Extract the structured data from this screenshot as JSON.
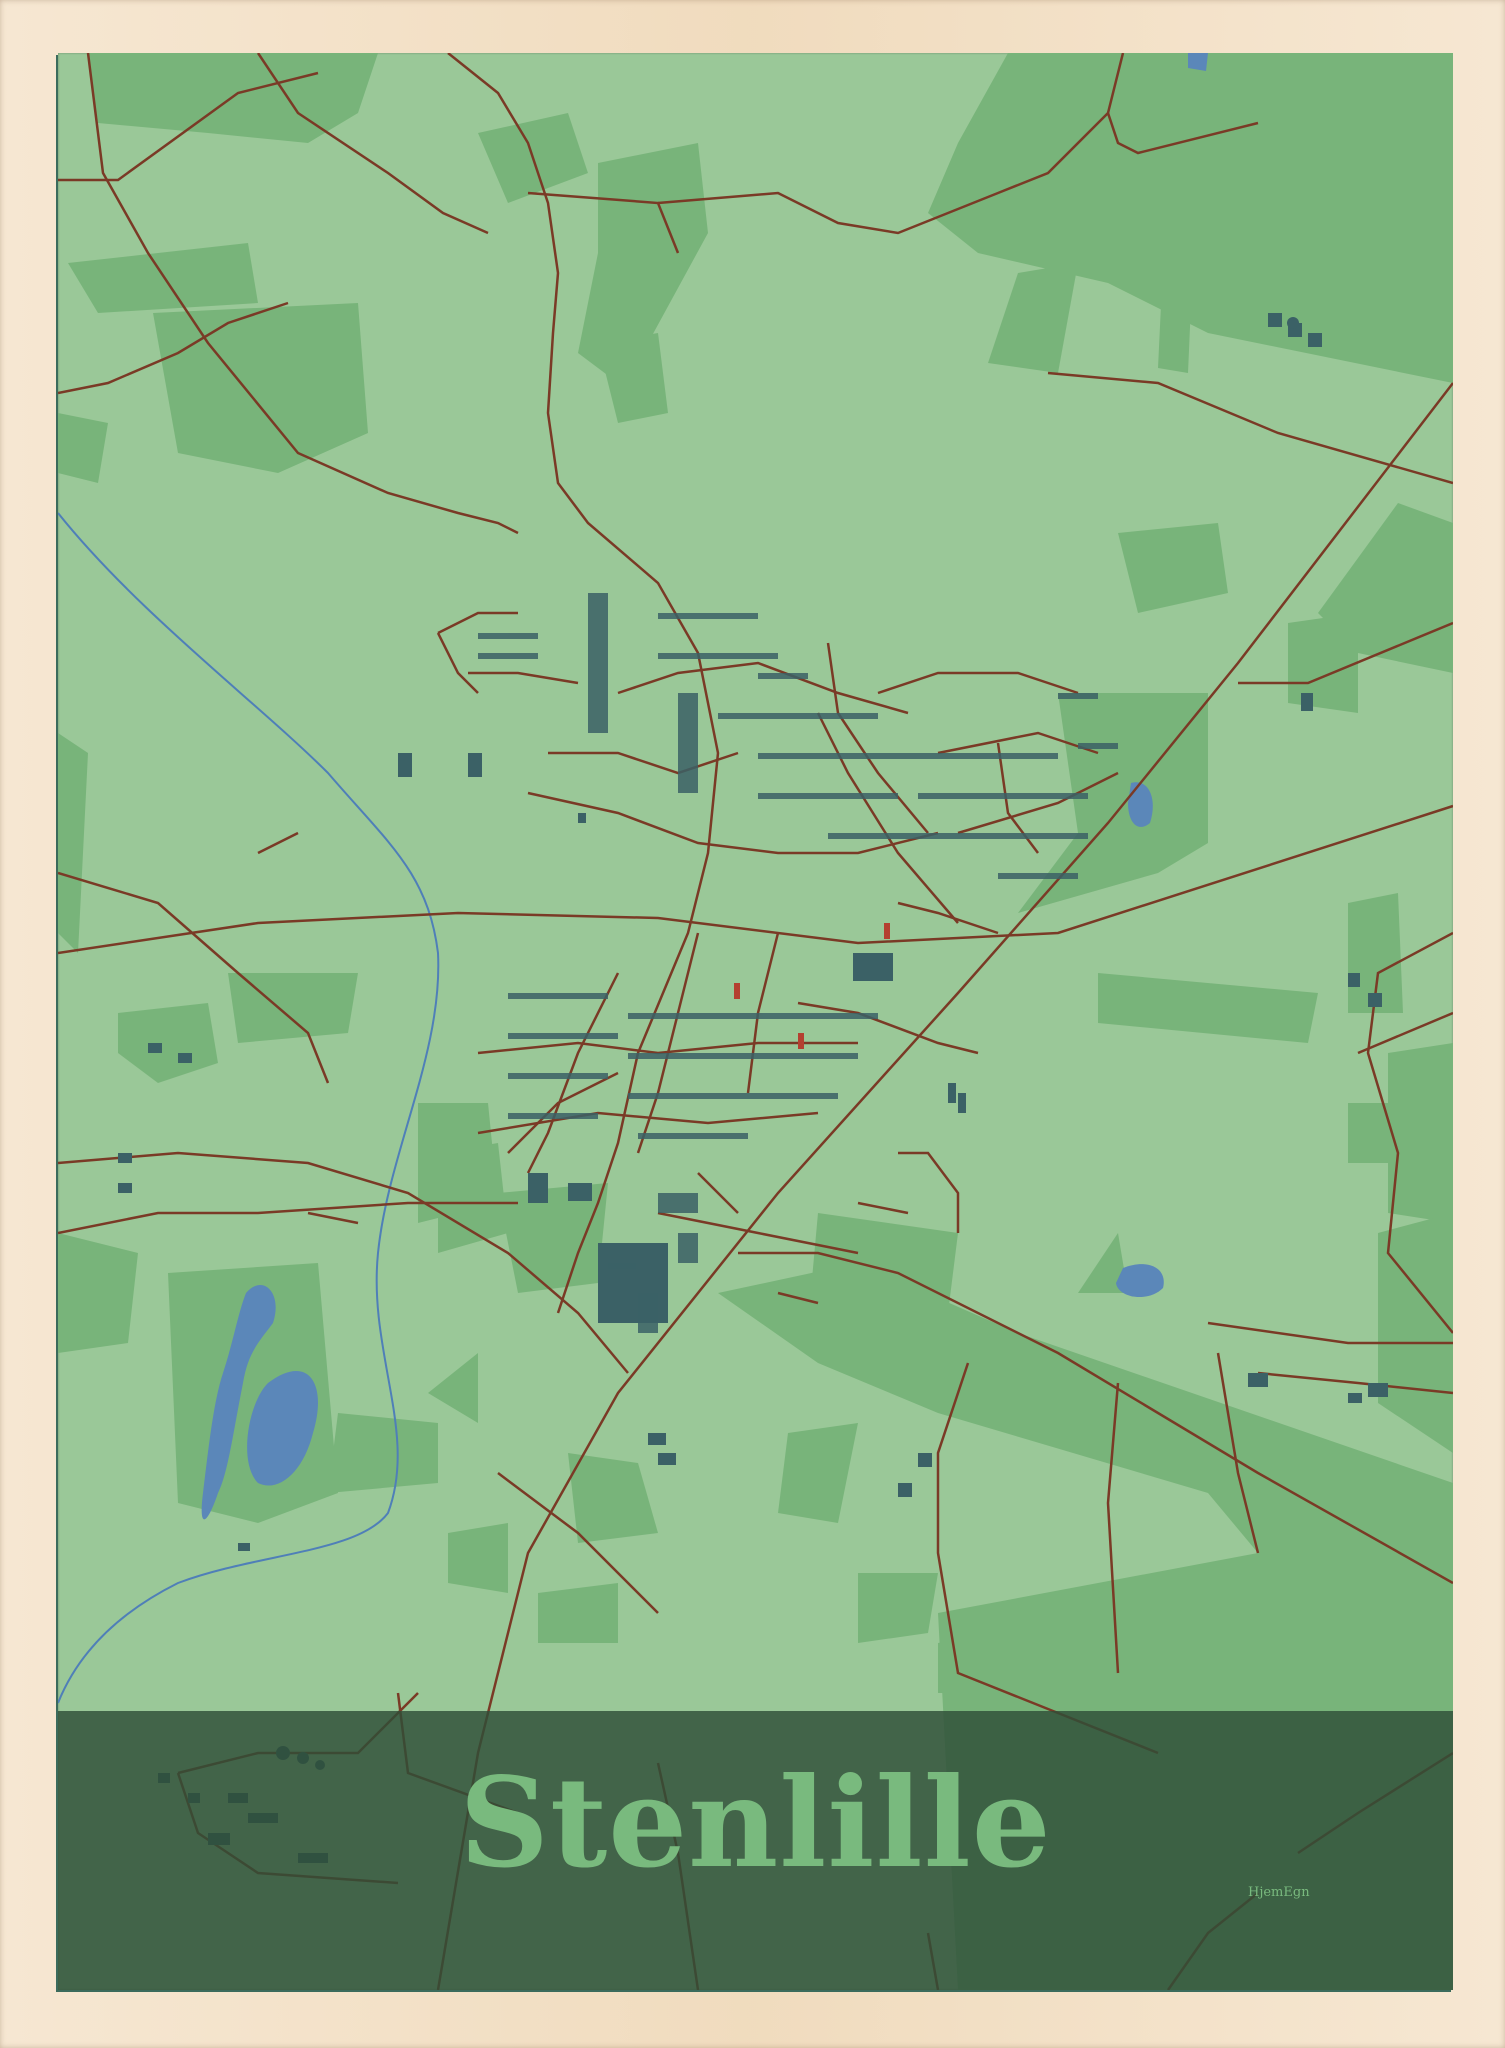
{
  "poster": {
    "title": "Stenlille",
    "brand": "HjemEgn"
  },
  "palette": {
    "frame": "#f3dfc3",
    "land": "#9ac898",
    "forest": "#78b47a",
    "water": "#5b87b9",
    "roads": "#7a3a26",
    "buildings": "#3b6166",
    "title_band": "#2e4e38",
    "title_text": "#79ba7e"
  }
}
